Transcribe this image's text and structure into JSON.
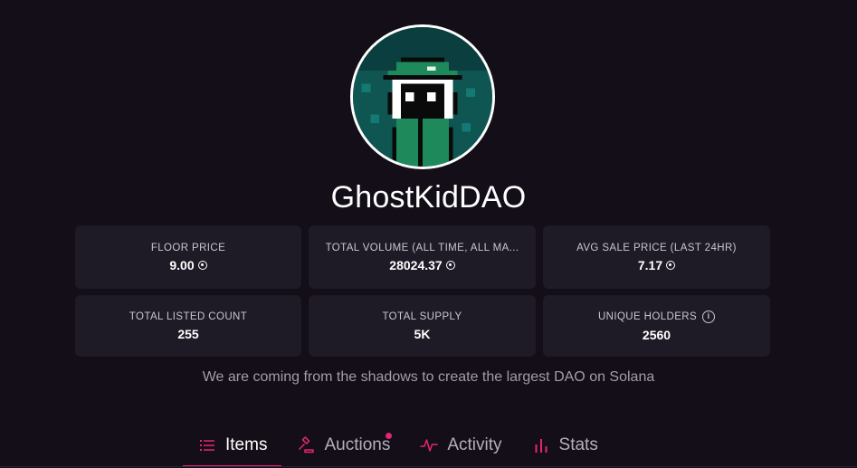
{
  "collection": {
    "name": "GhostKidDAO",
    "description": "We are coming from the shadows to create the largest DAO on Solana",
    "avatar_icon": "ghost-kid-pixel-avatar"
  },
  "stats": [
    {
      "label": "FLOOR PRICE",
      "value": "9.00",
      "currency_icon": "sol-icon"
    },
    {
      "label": "TOTAL VOLUME (ALL TIME, ALL MA...",
      "value": "28024.37",
      "currency_icon": "sol-icon"
    },
    {
      "label": "AVG SALE PRICE (LAST 24HR)",
      "value": "7.17",
      "currency_icon": "sol-icon"
    },
    {
      "label": "TOTAL LISTED COUNT",
      "value": "255"
    },
    {
      "label": "TOTAL SUPPLY",
      "value": "5K"
    },
    {
      "label": "UNIQUE HOLDERS",
      "value": "2560",
      "info_icon": "info-icon"
    }
  ],
  "tabs": [
    {
      "label": "Items",
      "icon": "list-icon",
      "active": true
    },
    {
      "label": "Auctions",
      "icon": "gavel-icon",
      "notification_dot": true
    },
    {
      "label": "Activity",
      "icon": "activity-icon"
    },
    {
      "label": "Stats",
      "icon": "bar-chart-icon"
    }
  ],
  "colors": {
    "background": "#130e18",
    "card": "#1e1b26",
    "accent": "#e42575"
  }
}
